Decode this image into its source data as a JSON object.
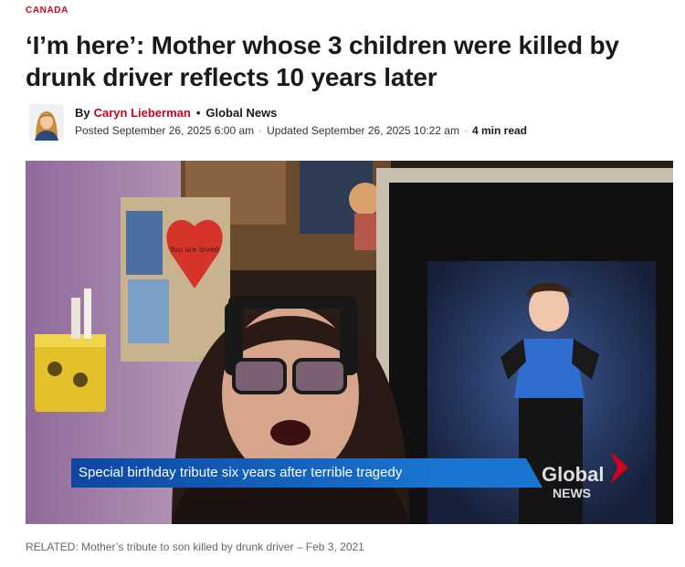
{
  "article": {
    "section": "CANADA",
    "headline": "‘I’m here’: Mother whose 3 children were killed by drunk driver reflects 10 years later",
    "byline": {
      "by_label": "By",
      "author": "Caryn Lieberman",
      "separator": "•",
      "outlet": "Global News",
      "posted": "Posted September 26, 2025 6:00 am",
      "updated": "Updated September 26, 2025 10:22 am",
      "dot": "·",
      "read_time": "4 min read"
    }
  },
  "media": {
    "lower_third": "Special birthday tribute six years after terrible tragedy",
    "logo_top": "Global",
    "logo_bottom": "NEWS",
    "sign_text": "You are loved",
    "brand_color": "#1565c0",
    "logo_color": "#d0021b"
  },
  "related": {
    "text": "RELATED: Mother’s tribute to son killed by drunk driver – Feb 3, 2021"
  }
}
